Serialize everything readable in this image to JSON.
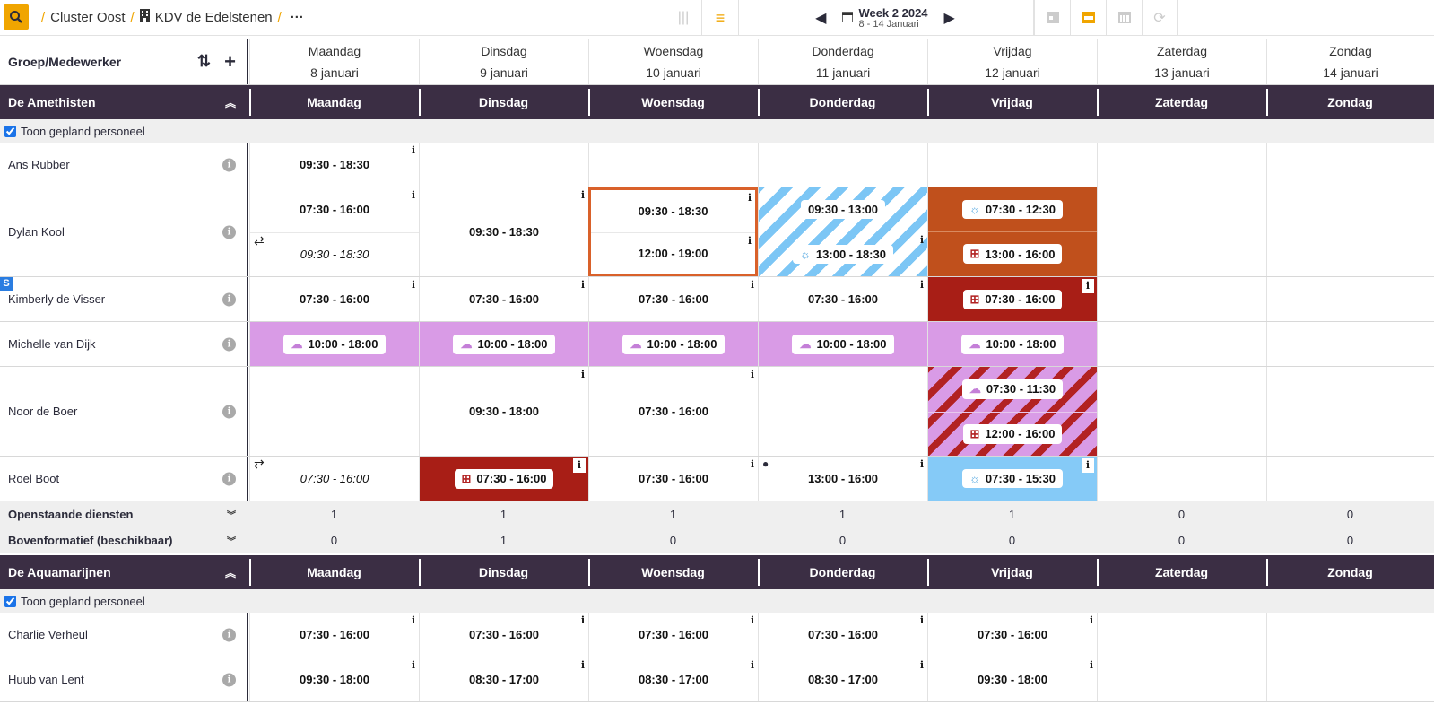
{
  "breadcrumb": {
    "cluster": "Cluster Oost",
    "location": "KDV de Edelstenen",
    "more": "···"
  },
  "week": {
    "title": "Week 2 2024",
    "range": "8 - 14 Januari"
  },
  "header": {
    "label": "Groep/Medewerker",
    "days": [
      {
        "name": "Maandag",
        "date": "8 januari"
      },
      {
        "name": "Dinsdag",
        "date": "9 januari"
      },
      {
        "name": "Woensdag",
        "date": "10 januari"
      },
      {
        "name": "Donderdag",
        "date": "11 januari"
      },
      {
        "name": "Vrijdag",
        "date": "12 januari"
      },
      {
        "name": "Zaterdag",
        "date": "13 januari"
      },
      {
        "name": "Zondag",
        "date": "14 januari"
      }
    ]
  },
  "groups": [
    {
      "name": "De Amethisten",
      "days": [
        "Maandag",
        "Dinsdag",
        "Woensdag",
        "Donderdag",
        "Vrijdag",
        "Zaterdag",
        "Zondag"
      ],
      "show_planned": "Toon gepland personeel",
      "employees": [
        "Ans Rubber",
        "Dylan Kool",
        "Kimberly de Visser",
        "Michelle van Dijk",
        "Noor de Boer",
        "Roel Boot"
      ],
      "shifts": {
        "ans_mon": "09:30 - 18:30",
        "dylan_mon_1": "07:30 - 16:00",
        "dylan_mon_2": "09:30 - 18:30",
        "dylan_tue": "09:30 - 18:30",
        "dylan_wed_1": "09:30 - 18:30",
        "dylan_wed_2": "12:00 - 19:00",
        "dylan_thu_1": "09:30 - 13:00",
        "dylan_thu_2": "13:00 - 18:30",
        "dylan_fri_1": "07:30 - 12:30",
        "dylan_fri_2": "13:00 - 16:00",
        "kim_mon": "07:30 - 16:00",
        "kim_tue": "07:30 - 16:00",
        "kim_wed": "07:30 - 16:00",
        "kim_thu": "07:30 - 16:00",
        "kim_fri": "07:30 - 16:00",
        "mich": "10:00 - 18:00",
        "noor_tue": "09:30 - 18:00",
        "noor_wed": "07:30 - 16:00",
        "noor_fri_1": "07:30 - 11:30",
        "noor_fri_2": "12:00 - 16:00",
        "roel_mon": "07:30 - 16:00",
        "roel_tue": "07:30 - 16:00",
        "roel_wed": "07:30 - 16:00",
        "roel_thu": "13:00 - 16:00",
        "roel_fri": "07:30 - 15:30"
      },
      "open_label": "Openstaande diensten",
      "open": [
        "1",
        "1",
        "1",
        "1",
        "1",
        "0",
        "0"
      ],
      "extra_label": "Bovenformatief (beschikbaar)",
      "extra": [
        "0",
        "1",
        "0",
        "0",
        "0",
        "0",
        "0"
      ]
    },
    {
      "name": "De Aquamarijnen",
      "days": [
        "Maandag",
        "Dinsdag",
        "Woensdag",
        "Donderdag",
        "Vrijdag",
        "Zaterdag",
        "Zondag"
      ],
      "show_planned": "Toon gepland personeel",
      "employees": [
        "Charlie Verheul",
        "Huub van Lent"
      ],
      "charlie": [
        "07:30 - 16:00",
        "07:30 - 16:00",
        "07:30 - 16:00",
        "07:30 - 16:00",
        "07:30 - 16:00"
      ],
      "huub": [
        "09:30 - 18:00",
        "08:30 - 17:00",
        "08:30 - 17:00",
        "08:30 - 17:00",
        "09:30 - 18:00"
      ]
    }
  ],
  "badge_s": "S",
  "colors": {
    "accent": "#f0a500",
    "group_bar": "#3b2e44",
    "orange": "#c0501c",
    "red": "#a81e16",
    "lilac": "#d99be6",
    "blue": "#85caf7"
  }
}
